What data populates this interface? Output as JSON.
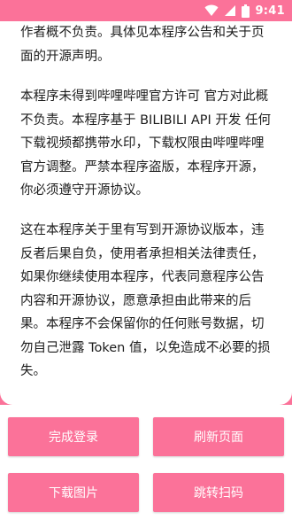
{
  "status_bar": {
    "time": "9:41",
    "icons": [
      "wifi-icon",
      "signal-icon",
      "battery-icon"
    ]
  },
  "content": {
    "paragraph_1": "作者概不负责。具体见本程序公告和关于页面的开源声明。",
    "paragraph_2": "本程序未得到哔哩哔哩官方许可 官方对此概不负责。本程序基于 BILIBILI API 开发 任何下载视频都携带水印，下载权限由哔哩哔哩官方调整。严禁本程序盗版，本程序开源，你必须遵守开源协议。",
    "paragraph_3": "这在本程序关于里有写到开源协议版本，违反者后果自负，使用者承担相关法律责任，如果你继续使用本程序，代表同意程序公告内容和开源协议，愿意承担由此带来的后果。本程序不会保留你的任何账号数据，切勿自己泄露 Token 值，以免造成不必要的损失。"
  },
  "buttons": {
    "complete_login": "完成登录",
    "refresh_page": "刷新页面",
    "download_image": "下载图片",
    "jump_scan": "跳转扫码"
  },
  "colors": {
    "accent": "#fb7299",
    "background": "#ffffff",
    "text": "#1c1c1c"
  }
}
